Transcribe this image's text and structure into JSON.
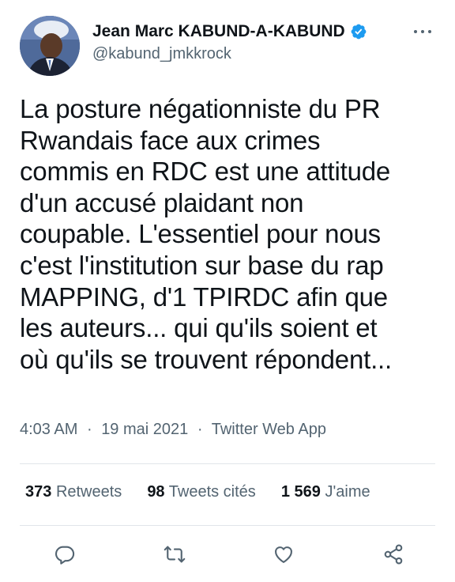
{
  "author": {
    "display_name": "Jean Marc KABUND-A-KABUND",
    "handle": "@kabund_jmkkrock"
  },
  "tweet": {
    "text": "La posture négationniste du PR\nRwandais face aux crimes\ncommis en RDC est une attitude\nd'un accusé plaidant non\ncoupable. L'essentiel pour nous\nc'est l'institution sur base du rap\nMAPPING, d'1 TPIRDC afin que\nles auteurs... qui qu'ils soient et\noù qu'ils se trouvent répondent...",
    "time": "4:03 AM",
    "separator": "·",
    "date": "19 mai 2021",
    "source": "Twitter Web App"
  },
  "stats": {
    "retweets_count": "373",
    "retweets_label": "Retweets",
    "quotes_count": "98",
    "quotes_label": "Tweets cités",
    "likes_count": "1 569",
    "likes_label": "J'aime"
  },
  "icons": {
    "verified": "verified-badge-icon",
    "more": "more-dots-icon",
    "reply": "reply-icon",
    "retweet": "retweet-icon",
    "like": "heart-icon",
    "share": "share-icon"
  },
  "colors": {
    "verified_blue": "#1d9bf0",
    "text_primary": "#0f1419",
    "text_secondary": "#536471",
    "divider": "#e1e5e9"
  }
}
